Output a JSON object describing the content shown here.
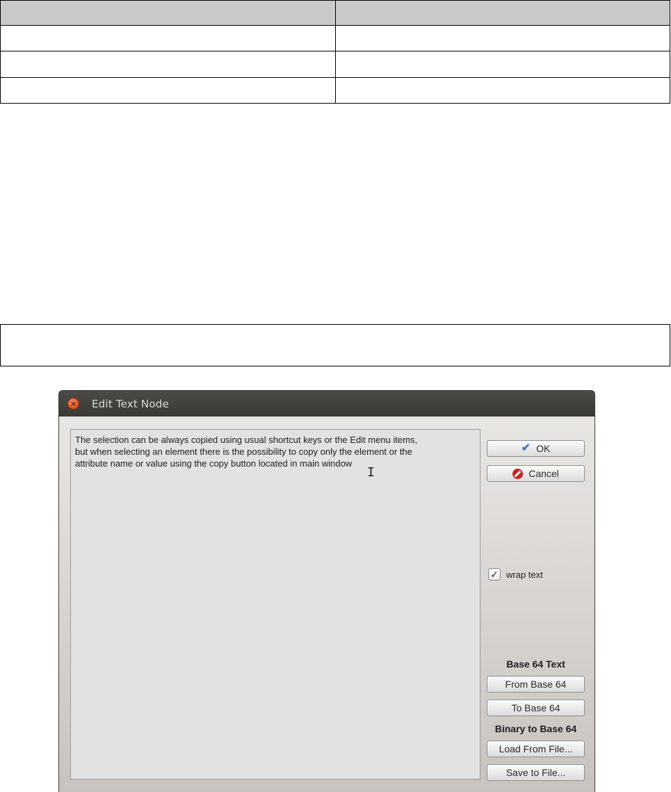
{
  "table": {
    "header": [
      "",
      ""
    ],
    "rows": [
      [
        "",
        ""
      ],
      [
        "",
        ""
      ],
      [
        "",
        ""
      ]
    ]
  },
  "dialog": {
    "title": "Edit Text Node",
    "text": "The selection can be always copied using usual shortcut keys or the Edit menu items,\nbut when selecting an element there is the possibility to copy only the element or the\nattribute name or value using the copy button located in main window",
    "ok_label": "OK",
    "cancel_label": "Cancel",
    "wrap_label": "wrap text",
    "wrap_checked": true,
    "base64_heading": "Base 64 Text",
    "from_base64_label": "From Base 64",
    "to_base64_label": "To Base 64",
    "binary_heading": "Binary to Base 64",
    "load_label": "Load From File...",
    "save_label": "Save to File..."
  },
  "icons": {
    "close": "close-icon",
    "ok": "checkmark-icon",
    "cancel": "no-entry-icon",
    "cursor": "text-cursor-icon"
  },
  "colors": {
    "titlebar": "#3b3a37",
    "close_button": "#e05a2c",
    "cancel_icon": "#cc1f1f",
    "ok_icon": "#4a78c0"
  }
}
